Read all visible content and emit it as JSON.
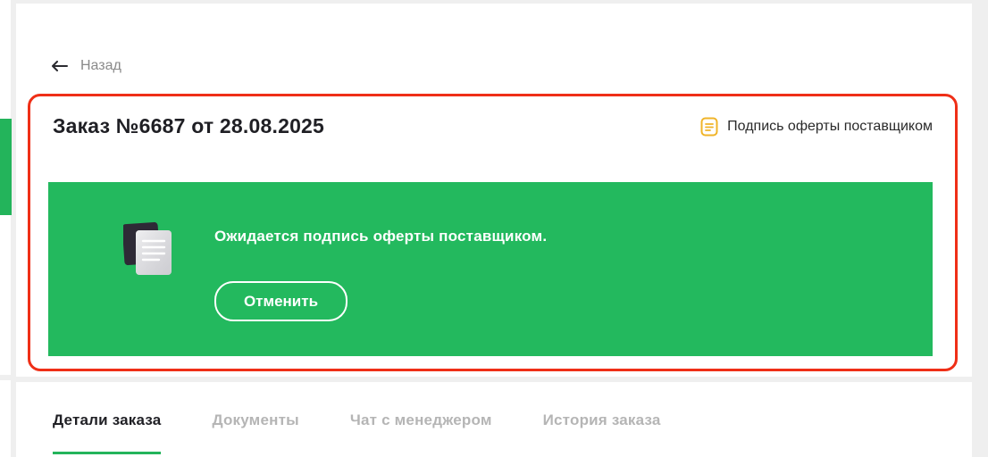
{
  "nav": {
    "back_label": "Назад"
  },
  "order": {
    "title": "Заказ №6687 от 28.08.2025",
    "status_label": "Подпись оферты поставщиком"
  },
  "banner": {
    "message": "Ожидается подпись оферты поставщиком.",
    "cancel_label": "Отменить"
  },
  "tabs": [
    {
      "label": "Детали заказа",
      "active": true
    },
    {
      "label": "Документы",
      "active": false
    },
    {
      "label": "Чат с менеджером",
      "active": false
    },
    {
      "label": "История заказа",
      "active": false
    }
  ],
  "colors": {
    "accent_green": "#23b95e",
    "highlight_red": "#ef2f17",
    "status_icon": "#f0b429"
  },
  "icons": {
    "back": "arrow-left-icon",
    "status": "document-status-icon",
    "illustration": "documents-icon"
  }
}
